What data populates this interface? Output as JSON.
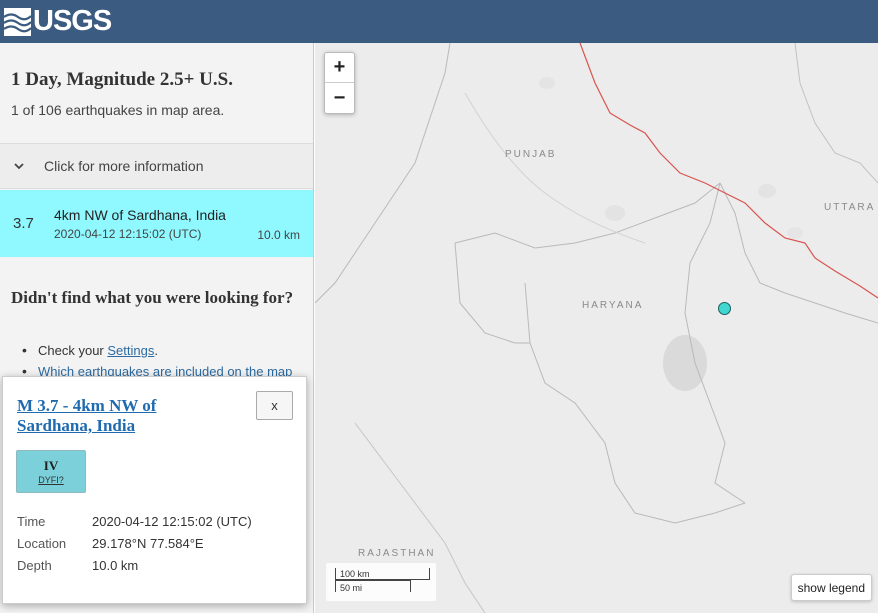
{
  "header": {
    "logo_text": "USGS",
    "colors": {
      "bar": "#3b5b80"
    }
  },
  "sidebar": {
    "title": "1 Day, Magnitude 2.5+ U.S.",
    "count_text": "1 of 106 earthquakes in map area.",
    "more_info_label": "Click for more information",
    "earthquakes": [
      {
        "mag": "3.7",
        "place": "4km NW of Sardhana, India",
        "time": "2020-04-12 12:15:02 (UTC)",
        "depth": "10.0 km",
        "highlight_color": "#8ff9ff"
      }
    ],
    "not_found_heading": "Didn't find what you were looking for?",
    "tip_prefix": "Check your ",
    "tip_settings_link": "Settings",
    "tip_suffix": ".",
    "tip_included_link": "Which earthquakes are included on the map"
  },
  "map": {
    "zoom_in": "+",
    "zoom_out": "−",
    "labels": {
      "punjab": "PUNJAB",
      "haryana": "HARYANA",
      "uttarakhand": "UTTARA",
      "rajasthan": "RAJASTHAN"
    },
    "scale": {
      "km": "100 km",
      "mi": "50 mi"
    },
    "legend_button": "show legend",
    "marker_color": "#41d7d0"
  },
  "popup": {
    "title": "M 3.7 - 4km NW of Sardhana, India",
    "close_label": "x",
    "dyfi_intensity": "IV",
    "dyfi_label": "DYFI?",
    "details": [
      {
        "key": "Time",
        "value": "2020-04-12 12:15:02 (UTC)"
      },
      {
        "key": "Location",
        "value": "29.178°N 77.584°E"
      },
      {
        "key": "Depth",
        "value": "10.0 km"
      }
    ]
  }
}
